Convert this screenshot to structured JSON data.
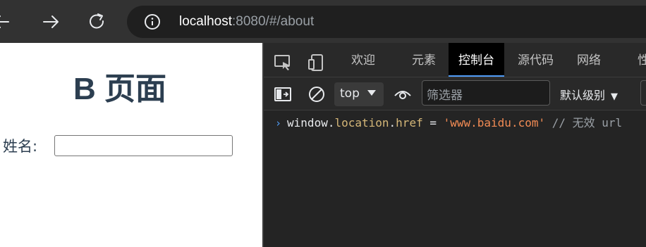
{
  "browser": {
    "url_host": "localhost",
    "url_rest": ":8080/#/about",
    "icons": [
      "back-icon",
      "forward-icon",
      "reload-icon",
      "info-icon"
    ]
  },
  "page": {
    "title": "B 页面",
    "name_label": "姓名:",
    "name_value": ""
  },
  "devtools": {
    "tabs": [
      "欢迎",
      "元素",
      "控制台",
      "源代码",
      "网络",
      "性"
    ],
    "active_tab": "控制台",
    "context": "top",
    "filter_placeholder": "筛选器",
    "level": "默认级别",
    "console": {
      "object": "window",
      "dot1": ".",
      "prop1": "location",
      "dot2": ".",
      "prop2": "href",
      "op": " = ",
      "string": "'www.baidu.com'",
      "comment": " // 无效 url"
    }
  },
  "colors": {
    "accent": "#4f9bf6",
    "title": "#2c3e50",
    "string": "#f28b54",
    "property": "#d5b778"
  }
}
